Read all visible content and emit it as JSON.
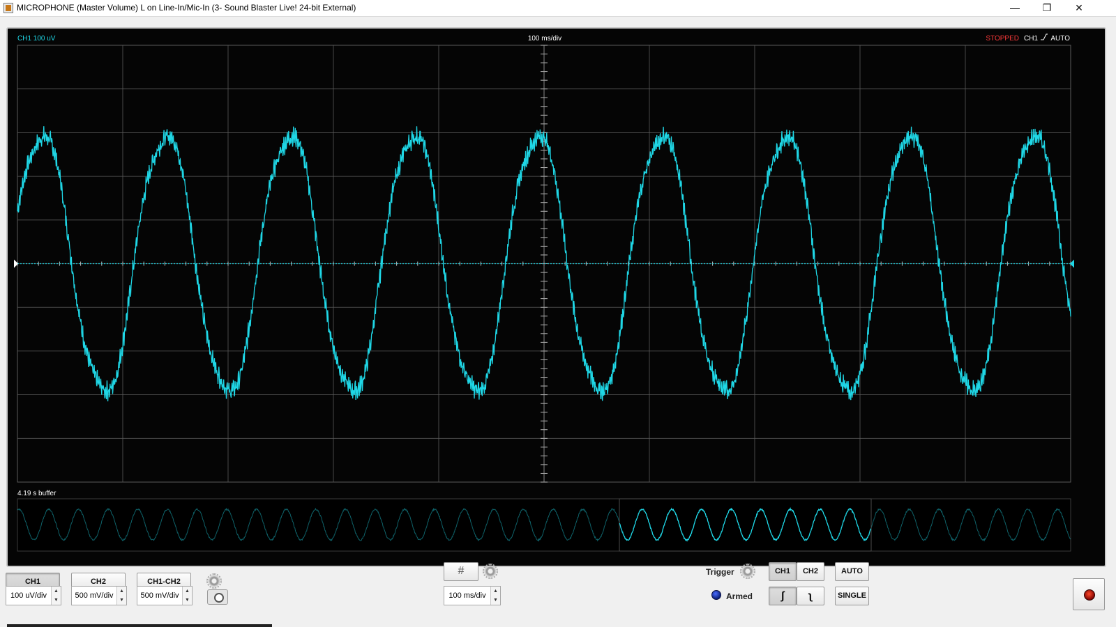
{
  "window": {
    "title": "MICROPHONE (Master Volume) L on Line-In/Mic-In (3- Sound Blaster Live! 24-bit External)",
    "minimize_glyph": "—",
    "restore_glyph": "❐",
    "close_glyph": "✕"
  },
  "scope": {
    "ch1_label": "CH1 100 uV",
    "timebase_label": "100 ms/div",
    "status": "STOPPED",
    "trigger_channel": "CH1",
    "trigger_mode": "AUTO",
    "buffer_label": "4.19 s buffer",
    "trace_color": "#1fd7e6",
    "status_color": "#ff3a3a",
    "grid_color": "#5a5a5a",
    "divisions": {
      "horizontal": 10,
      "vertical": 10
    },
    "waveform": {
      "shape": "noisy sine",
      "cycles_on_screen": 8.5,
      "amplitude_divisions": 3.0
    }
  },
  "controls": {
    "ch1_button": "CH1",
    "ch2_button": "CH2",
    "ch1_minus_ch2_button": "CH1-CH2",
    "ch1_scale": "100 uV/div",
    "ch2_scale": "500 mV/div",
    "diff_scale": "500 mV/div",
    "timebase_scale": "100 ms/div",
    "trigger_label": "Trigger",
    "trigger_ch1": "CH1",
    "trigger_ch2": "CH2",
    "auto_button": "AUTO",
    "single_button": "SINGLE",
    "armed_label": "Armed",
    "rising_glyph": "ʃ",
    "falling_glyph": "ʅ",
    "grid_glyph": "#",
    "spin_up": "▲",
    "spin_down": "▼"
  }
}
